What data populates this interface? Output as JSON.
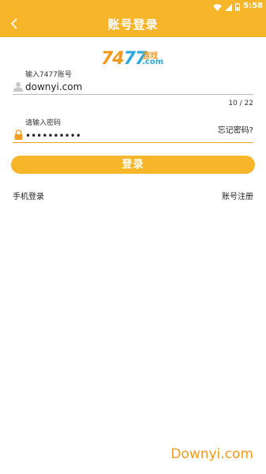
{
  "status_bar": {
    "time": "5:58",
    "icons": [
      "wifi-icon",
      "signal-icon",
      "battery-icon"
    ],
    "color": "#f7b52a"
  },
  "app_bar": {
    "title": "账号登录",
    "back_icon": "chevron-left-icon"
  },
  "logo": {
    "number_part1": "74",
    "number_part2": "77",
    "cn_text": "游戏",
    "domain_text": ".com"
  },
  "account_field": {
    "label": "输入7477账号",
    "value": "downyi.com",
    "icon": "user-icon",
    "counter": "10 / 22"
  },
  "password_field": {
    "label": "请输入密码",
    "value": "••••••••••",
    "icon": "lock-icon",
    "forgot_label": "忘记密码?"
  },
  "login_button": {
    "label": "登录"
  },
  "links": {
    "phone_login": "手机登录",
    "register": "账号注册"
  },
  "watermark": "Downyi.com",
  "colors": {
    "accent": "#f7b52a",
    "logo_orange": "#f39a1d",
    "logo_blue": "#2aa7dc",
    "underline_active": "#f0a020",
    "underline_idle": "#bbbbbb"
  }
}
